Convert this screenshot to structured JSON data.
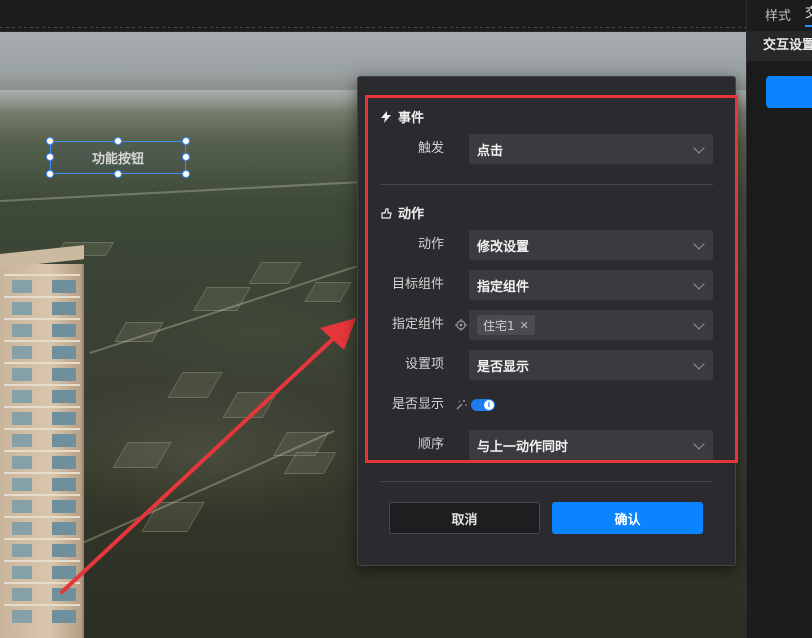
{
  "right_panel": {
    "tabs": [
      {
        "label": "样式",
        "active": false
      },
      {
        "label": "交",
        "active": true
      }
    ],
    "section_title": "交互设置"
  },
  "scene": {
    "function_button_label": "功能按钮"
  },
  "modal": {
    "event_section": {
      "title": "事件",
      "icon": "lightning-icon",
      "trigger_label": "触发",
      "trigger_value": "点击"
    },
    "action_section": {
      "title": "动作",
      "icon": "action-icon",
      "action_label": "动作",
      "action_value": "修改设置",
      "target_component_label": "目标组件",
      "target_component_value": "指定组件",
      "specified_component_label": "指定组件",
      "specified_component_tag": "住宅1",
      "setting_item_label": "设置项",
      "setting_item_value": "是否显示",
      "visible_label": "是否显示",
      "visible_on": true,
      "order_label": "顺序",
      "order_value": "与上一动作同时"
    },
    "cancel_label": "取消",
    "confirm_label": "确认"
  },
  "colors": {
    "accent": "#0a84ff",
    "highlight_border": "#e5373b",
    "modal_bg": "#2b2b2f",
    "field_bg": "#3a3a3f"
  }
}
